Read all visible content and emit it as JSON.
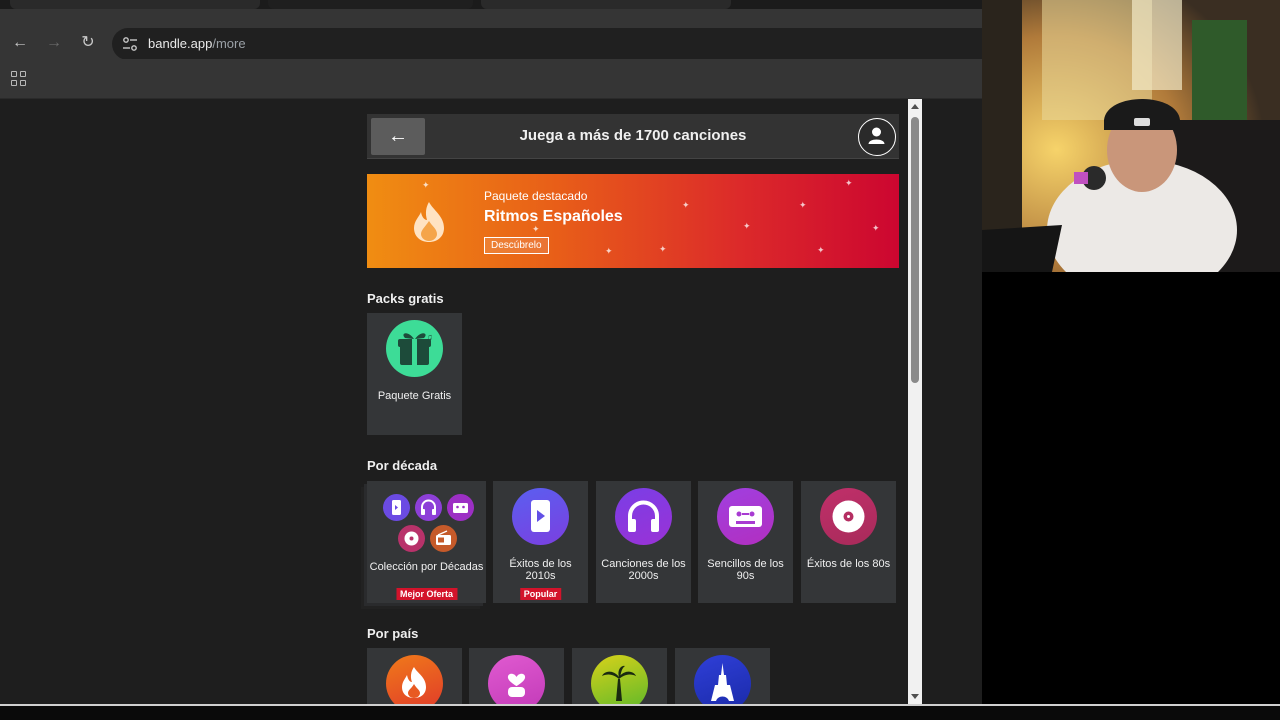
{
  "browser": {
    "url_host": "bandle.app",
    "url_path": "/more"
  },
  "header": {
    "title": "Juega a más de 1700 canciones"
  },
  "featured": {
    "kicker": "Paquete destacado",
    "name": "Ritmos Españoles",
    "cta": "Descúbrelo"
  },
  "free_packs": {
    "title": "Packs gratis",
    "items": [
      {
        "label": "Paquete Gratis",
        "icon": "gift-icon"
      }
    ]
  },
  "decades": {
    "title": "Por década",
    "items": [
      {
        "label": "Colección por Décadas",
        "badge": "Mejor Oferta",
        "icon": "collection-icon"
      },
      {
        "label": "Éxitos de los 2010s",
        "badge": "Popular",
        "icon": "phone-icon"
      },
      {
        "label": "Canciones de los 2000s",
        "icon": "headphones-icon"
      },
      {
        "label": "Sencillos de los 90s",
        "icon": "cassette-icon"
      },
      {
        "label": "Éxitos de los 80s",
        "icon": "vinyl-icon"
      }
    ]
  },
  "countries": {
    "title": "Por país",
    "items": [
      {
        "icon": "flame-icon"
      },
      {
        "icon": "heart-hand-icon"
      },
      {
        "icon": "palm-tree-icon"
      },
      {
        "icon": "eiffel-tower-icon"
      }
    ]
  },
  "colors": {
    "banner_start": "#f08d12",
    "banner_end": "#cc0630",
    "badge": "#d3132b",
    "free_pack": "#3ddc97",
    "decade_purple": "#7b3fe0"
  }
}
